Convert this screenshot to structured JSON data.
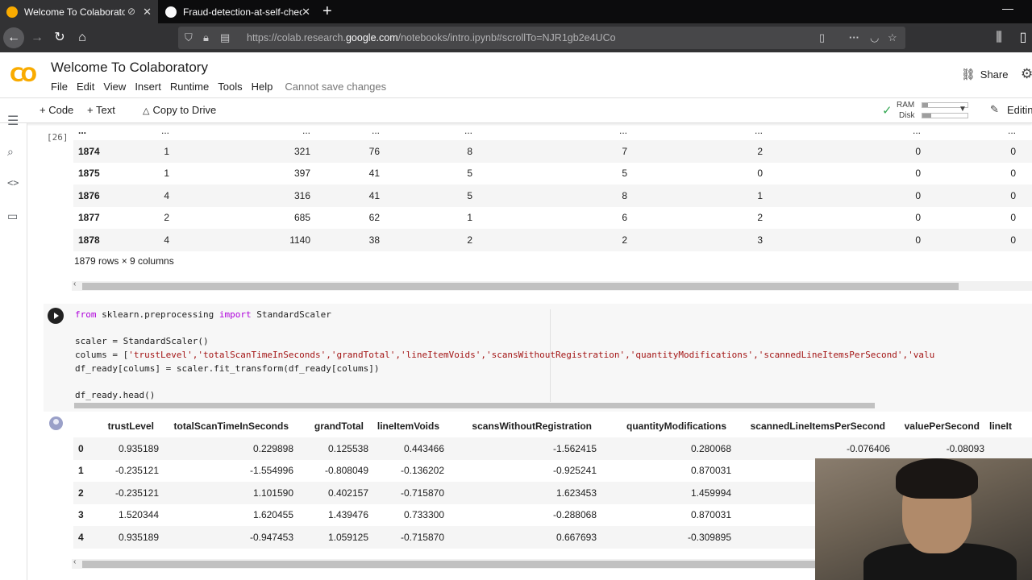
{
  "browser": {
    "tabs": [
      {
        "title": "Welcome To Colaboratory",
        "active": true
      },
      {
        "title": "Fraud-detection-at-self-checko",
        "active": false
      }
    ],
    "url_prefix": "https://colab.research.",
    "url_domain": "google.com",
    "url_suffix": "/notebooks/intro.ipynb#scrollTo=NJR1gb2e4UCo"
  },
  "colab": {
    "title": "Welcome To Colaboratory",
    "menu": [
      "File",
      "Edit",
      "View",
      "Insert",
      "Runtime",
      "Tools",
      "Help"
    ],
    "cannot_save": "Cannot save changes",
    "share": "Share",
    "toolbar": {
      "code": "+ Code",
      "text": "+ Text",
      "copy_to_drive": "Copy to Drive",
      "ram": "RAM",
      "disk": "Disk",
      "editing": "Editin"
    },
    "resources": {
      "ram_fraction": 0.12,
      "disk_fraction": 0.2
    }
  },
  "output1": {
    "exec_count": "[26]",
    "ellipsis_row": [
      "...",
      "...",
      "...",
      "...",
      "...",
      "...",
      "...",
      "...",
      "...",
      "..."
    ],
    "rows": [
      {
        "idx": "1874",
        "vals": [
          "1",
          "321",
          "76",
          "8",
          "7",
          "2",
          "0",
          "0"
        ]
      },
      {
        "idx": "1875",
        "vals": [
          "1",
          "397",
          "41",
          "5",
          "5",
          "0",
          "0",
          "0"
        ]
      },
      {
        "idx": "1876",
        "vals": [
          "4",
          "316",
          "41",
          "5",
          "8",
          "1",
          "0",
          "0"
        ]
      },
      {
        "idx": "1877",
        "vals": [
          "2",
          "685",
          "62",
          "1",
          "6",
          "2",
          "0",
          "0"
        ]
      },
      {
        "idx": "1878",
        "vals": [
          "4",
          "1140",
          "38",
          "2",
          "2",
          "3",
          "0",
          "0"
        ]
      }
    ],
    "shape": "1879 rows × 9 columns"
  },
  "code_cell": {
    "line1_kw1": "from",
    "line1_mid": " sklearn.preprocessing ",
    "line1_kw2": "import",
    "line1_end": " StandardScaler",
    "line2": "scaler = StandardScaler()",
    "line3_start": "colums = [",
    "line3_strings": "'trustLevel','totalScanTimeInSeconds','grandTotal','lineItemVoids','scansWithoutRegistration','quantityModifications','scannedLineItemsPerSecond','valu",
    "line4": "df_ready[colums] = scaler.fit_transform(df_ready[colums])",
    "line5": "df_ready.head()"
  },
  "output2": {
    "columns": [
      "trustLevel",
      "totalScanTimeInSeconds",
      "grandTotal",
      "lineItemVoids",
      "scansWithoutRegistration",
      "quantityModifications",
      "scannedLineItemsPerSecond",
      "valuePerSecond",
      "lineIt"
    ],
    "rows": [
      {
        "idx": "0",
        "vals": [
          "0.935189",
          "0.229898",
          "0.125538",
          "0.443466",
          "-1.562415",
          "0.280068",
          "-0.076406",
          "-0.08093"
        ]
      },
      {
        "idx": "1",
        "vals": [
          "-0.235121",
          "-1.554996",
          "-0.808049",
          "-0.136202",
          "-0.925241",
          "0.870031",
          "",
          ""
        ]
      },
      {
        "idx": "2",
        "vals": [
          "-0.235121",
          "1.101590",
          "0.402157",
          "-0.715870",
          "1.623453",
          "1.459994",
          "",
          ""
        ]
      },
      {
        "idx": "3",
        "vals": [
          "1.520344",
          "1.620455",
          "1.439476",
          "0.733300",
          "-0.288068",
          "0.870031",
          "",
          ""
        ]
      },
      {
        "idx": "4",
        "vals": [
          "0.935189",
          "-0.947453",
          "1.059125",
          "-0.715870",
          "0.667693",
          "-0.309895",
          "",
          ""
        ]
      }
    ]
  }
}
